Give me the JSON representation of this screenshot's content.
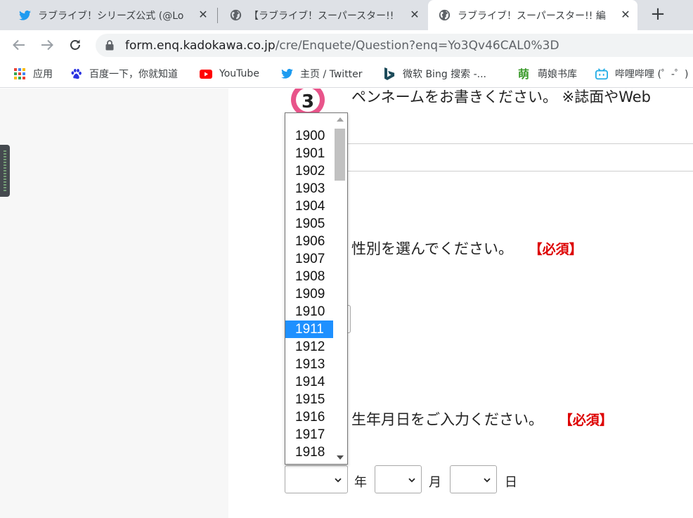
{
  "tabs": [
    {
      "title": "ラブライブ！シリーズ公式 (@Lo",
      "icon": "twitter-icon"
    },
    {
      "title": "【ラブライブ！スーパースター!!",
      "icon": "globe-icon"
    },
    {
      "title": "ラブライブ！スーパースター!! 編",
      "icon": "globe-icon",
      "active": true
    }
  ],
  "new_tab_label": "+",
  "close_glyph": "✕",
  "address": {
    "host": "form.enq.kadokawa.co.jp",
    "path": "/cre/Enquete/Question?enq=Yo3Qv46CAL0%3D"
  },
  "bookmarks": [
    {
      "label": "应用",
      "icon": "apps-grid-icon"
    },
    {
      "label": "百度一下，你就知道",
      "icon": "baidu-paw-icon"
    },
    {
      "label": "YouTube",
      "icon": "youtube-icon"
    },
    {
      "label": "主页 / Twitter",
      "icon": "twitter-icon"
    },
    {
      "label": "微软 Bing 搜索 -...",
      "icon": "bing-icon"
    },
    {
      "label": "萌娘书库",
      "icon": "moegirl-icon"
    },
    {
      "label": "哔哩哔哩 (゜-゜)",
      "icon": "bilibili-icon"
    }
  ],
  "form": {
    "q3_number": "3",
    "q3_text": "ペンネームをお書きください。 ※誌面やWeb",
    "q_gender": "性別を選んでください。",
    "q_birth": "生年月日をご入力ください。",
    "required": "【必須】",
    "unit_year": "年",
    "unit_month": "月",
    "unit_day": "日"
  },
  "year_dropdown": {
    "options": [
      "1900",
      "1901",
      "1902",
      "1903",
      "1904",
      "1905",
      "1906",
      "1907",
      "1908",
      "1909",
      "1910",
      "1911",
      "1912",
      "1913",
      "1914",
      "1915",
      "1916",
      "1917",
      "1918"
    ],
    "highlighted": "1911"
  },
  "colors": {
    "accent_select": "#1e90ff",
    "required": "#dd0000",
    "badge_pink": "#e8548a"
  }
}
